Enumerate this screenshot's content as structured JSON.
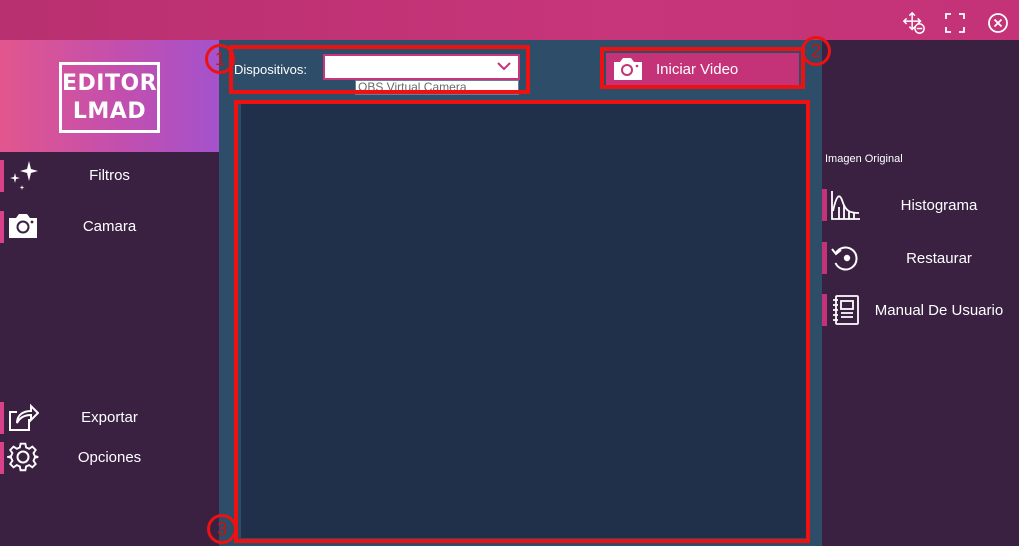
{
  "window": {
    "controls": {
      "move_icon": "move-arrows-icon",
      "maximize_icon": "maximize-icon",
      "close_icon": "close-circle-icon"
    }
  },
  "sidebar": {
    "logo_line1": "EDITOR",
    "logo_line2": "LMAD",
    "items": [
      {
        "label": "Filtros",
        "icon": "sparkles-icon"
      },
      {
        "label": "Camara",
        "icon": "camera-icon"
      },
      {
        "label": "Exportar",
        "icon": "share-export-icon"
      },
      {
        "label": "Opciones",
        "icon": "gear-icon"
      }
    ]
  },
  "main": {
    "devices_label": "Dispositivos:",
    "devices_selected": "",
    "devices_option": "OBS Virtual Camera",
    "start_video_label": "Iniciar Video"
  },
  "right_panel": {
    "title": "Imagen Original",
    "items": [
      {
        "label": "Histograma",
        "icon": "histogram-icon"
      },
      {
        "label": "Restaurar",
        "icon": "restore-icon"
      },
      {
        "label": "Manual De Usuario",
        "icon": "notebook-icon"
      }
    ]
  },
  "annotations": {
    "n1": "1",
    "n2": "2",
    "n3": "3"
  },
  "colors": {
    "accent": "#c43277",
    "sidebar_bg": "#3a2142",
    "main_bg": "#2d4d68",
    "video_bg": "#21304a",
    "annotation": "#ee1111"
  }
}
